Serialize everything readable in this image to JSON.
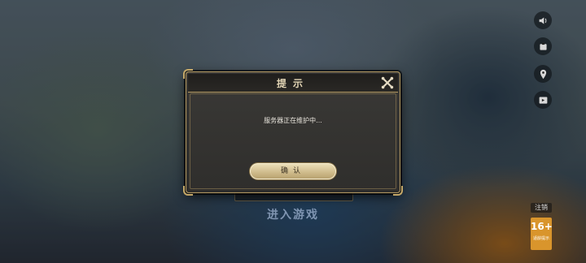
{
  "dialog": {
    "title": "提示",
    "message": "服务器正在维护中...",
    "confirm_label": "确认"
  },
  "main": {
    "enter_game_label": "进入游戏"
  },
  "side_buttons": {
    "icons": [
      "speaker-icon",
      "notice-icon",
      "location-icon",
      "video-icon"
    ]
  },
  "logout_label": "注销",
  "age_rating": {
    "value": "16+",
    "caption": "适龄提示"
  },
  "colors": {
    "gold_accent": "#b59a62",
    "button_gold": "#cdb989",
    "age_badge": "#d9952c"
  }
}
